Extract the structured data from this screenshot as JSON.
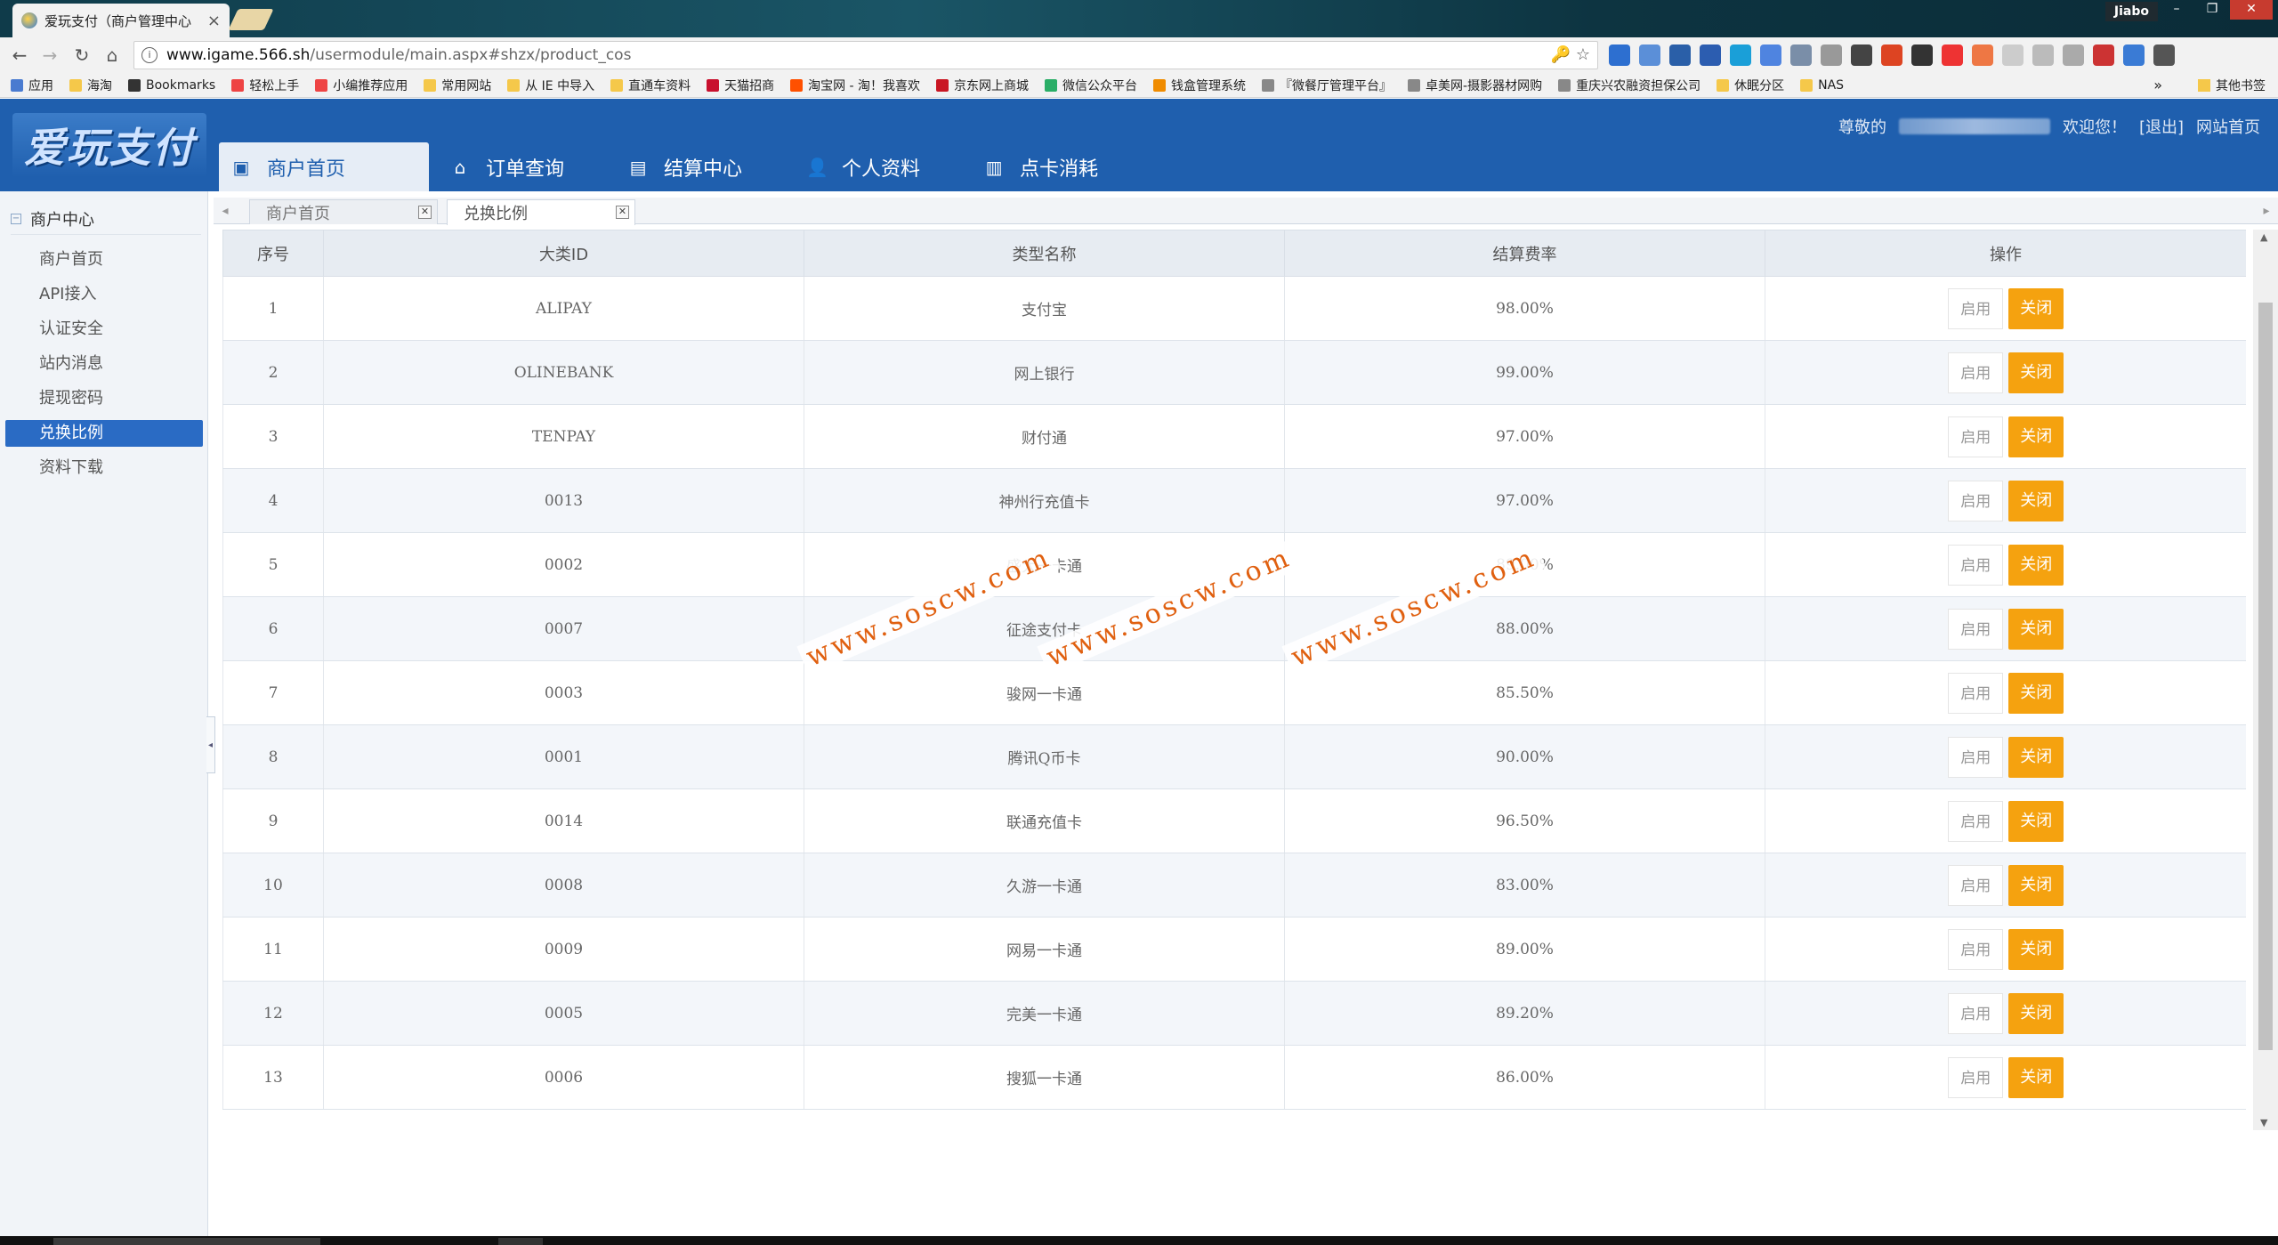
{
  "browser": {
    "tab_title": "爱玩支付（商户管理中心",
    "tab_close": "×",
    "user": "Jiabo",
    "win_min": "–",
    "win_max": "❐",
    "win_close": "✕",
    "url_host": "www.igame.566.sh",
    "url_path": "/usermodule/main.aspx#shzx/product_cos",
    "omni_icons": "🔑 ☆",
    "bookmarks": [
      {
        "label": "应用",
        "icon": "apps-icon",
        "color": "#4a7bd0"
      },
      {
        "label": "海淘",
        "icon": "folder-icon",
        "color": "#f5c84a"
      },
      {
        "label": "Bookmarks",
        "icon": "star-icon",
        "color": "#333333"
      },
      {
        "label": "轻松上手",
        "icon": "chrome-icon",
        "color": "#e44"
      },
      {
        "label": "小编推荐应用",
        "icon": "chrome-icon",
        "color": "#e44"
      },
      {
        "label": "常用网站",
        "icon": "folder-icon",
        "color": "#f5c84a"
      },
      {
        "label": "从 IE 中导入",
        "icon": "folder-icon",
        "color": "#f5c84a"
      },
      {
        "label": "直通车资料",
        "icon": "folder-icon",
        "color": "#f5c84a"
      },
      {
        "label": "天猫招商",
        "icon": "tmall-icon",
        "color": "#c8102e"
      },
      {
        "label": "淘宝网 - 淘！我喜欢",
        "icon": "taobao-icon",
        "color": "#ff5000"
      },
      {
        "label": "京东网上商城",
        "icon": "jd-icon",
        "color": "#c91623"
      },
      {
        "label": "微信公众平台",
        "icon": "wechat-icon",
        "color": "#2aae67"
      },
      {
        "label": "钱盒管理系统",
        "icon": "hex-icon",
        "color": "#f08c00"
      },
      {
        "label": "『微餐厅管理平台』",
        "icon": "page-icon",
        "color": "#888888"
      },
      {
        "label": "卓美网-摄影器材网购",
        "icon": "page-icon",
        "color": "#888888"
      },
      {
        "label": "重庆兴农融资担保公司",
        "icon": "page-icon",
        "color": "#888888"
      },
      {
        "label": "休眠分区",
        "icon": "folder-icon",
        "color": "#f5c84a"
      },
      {
        "label": "NAS",
        "icon": "folder-icon",
        "color": "#f5c84a"
      }
    ],
    "bookmarks_more": "»",
    "other_bookmarks": "其他书签"
  },
  "app": {
    "logo": "爱玩支付",
    "nav": [
      {
        "label": "商户首页",
        "icon": "home-page-icon",
        "glyph": "▣"
      },
      {
        "label": "订单查询",
        "icon": "house-icon",
        "glyph": "⌂"
      },
      {
        "label": "结算中心",
        "icon": "calculator-icon",
        "glyph": "▤"
      },
      {
        "label": "个人资料",
        "icon": "user-card-icon",
        "glyph": "👤"
      },
      {
        "label": "点卡消耗",
        "icon": "building-icon",
        "glyph": "▥"
      }
    ],
    "greeting_prefix": "尊敬的",
    "greeting_suffix": "欢迎您！",
    "logout": "[退出]",
    "site_home": "网站首页"
  },
  "sidebar": {
    "title": "商户中心",
    "items": [
      "商户首页",
      "API接入",
      "认证安全",
      "站内消息",
      "提现密码",
      "兑换比例",
      "资料下载"
    ],
    "active_index": 5
  },
  "tabs": [
    "商户首页",
    "兑换比例"
  ],
  "table": {
    "headers": [
      "序号",
      "大类ID",
      "类型名称",
      "结算费率",
      "操作"
    ],
    "enable_label": "启用",
    "disable_label": "关闭",
    "rows": [
      [
        "1",
        "ALIPAY",
        "支付宝",
        "98.00%"
      ],
      [
        "2",
        "OLINEBANK",
        "网上银行",
        "99.00%"
      ],
      [
        "3",
        "TENPAY",
        "财付通",
        "97.00%"
      ],
      [
        "4",
        "0013",
        "神州行充值卡",
        "97.00%"
      ],
      [
        "5",
        "0002",
        "盛大一卡通",
        "89.00%"
      ],
      [
        "6",
        "0007",
        "征途支付卡",
        "88.00%"
      ],
      [
        "7",
        "0003",
        "骏网一卡通",
        "85.50%"
      ],
      [
        "8",
        "0001",
        "腾讯Q币卡",
        "90.00%"
      ],
      [
        "9",
        "0014",
        "联通充值卡",
        "96.50%"
      ],
      [
        "10",
        "0008",
        "久游一卡通",
        "83.00%"
      ],
      [
        "11",
        "0009",
        "网易一卡通",
        "89.00%"
      ],
      [
        "12",
        "0005",
        "完美一卡通",
        "89.20%"
      ],
      [
        "13",
        "0006",
        "搜狐一卡通",
        "86.00%"
      ]
    ]
  },
  "watermark": "www.soscw.com"
}
